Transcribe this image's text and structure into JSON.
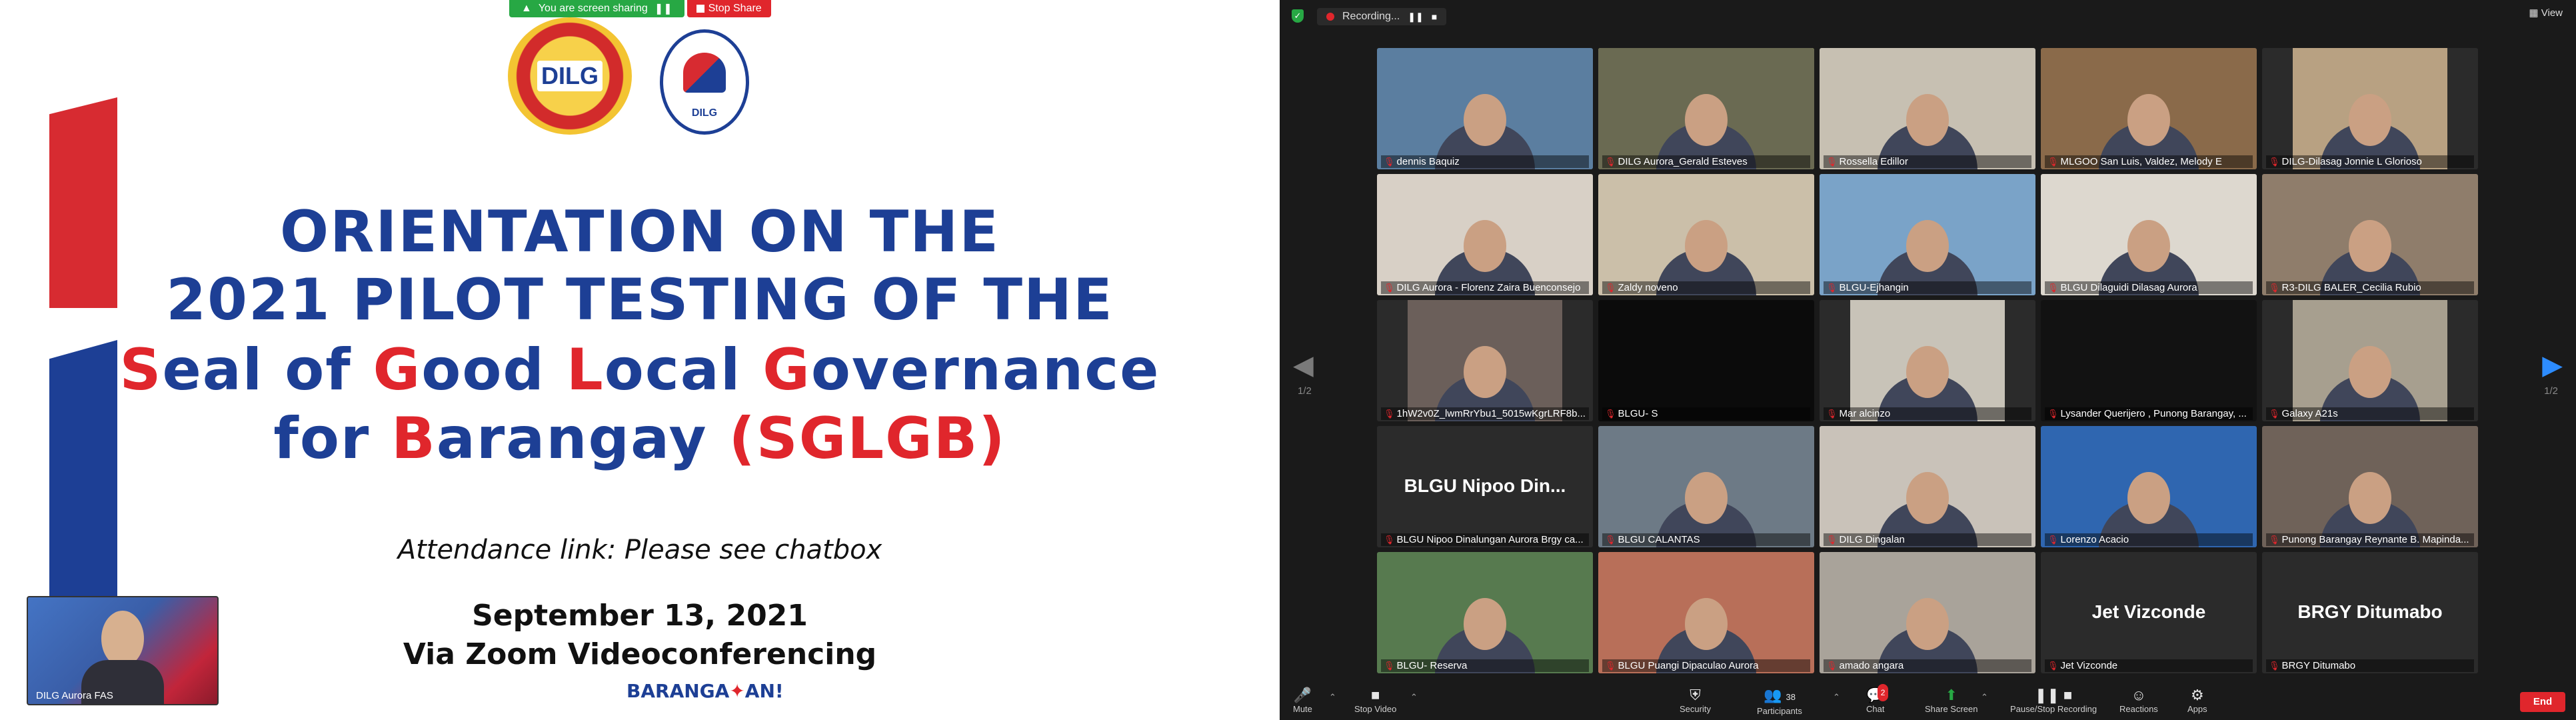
{
  "screen_share": {
    "sharing_text": "You are screen sharing",
    "stop_share_label": "Stop Share"
  },
  "slide": {
    "logo_dilg_text": "DILG",
    "logo_nbo_text": "DILG",
    "title_line1": "ORIENTATION ON THE",
    "title_line2": "2021 PILOT TESTING OF THE",
    "title_line3": {
      "w1_cap": "S",
      "w1_rest": "eal of ",
      "w2_cap": "G",
      "w2_rest": "ood ",
      "w3_cap": "L",
      "w3_rest": "ocal ",
      "w4_cap": "G",
      "w4_rest": "overnance"
    },
    "title_line4": {
      "pre": "for ",
      "cap": "B",
      "rest": "arangay ",
      "acronym": "(SGLGB)"
    },
    "attendance": "Attendance link: Please see chatbox",
    "date": "September 13, 2021",
    "venue": "Via Zoom Videoconferencing",
    "footer_logo_pre": "BARANGA",
    "footer_logo_post": "AN!",
    "self_view_name": "DILG Aurora FAS"
  },
  "zoom": {
    "recording_label": "Recording...",
    "view_label": "View",
    "page_indicator": "1/2",
    "participants": [
      {
        "name": "dennis Baquiz",
        "type": "video"
      },
      {
        "name": "DILG Aurora_Gerald Esteves",
        "type": "video",
        "active": true
      },
      {
        "name": "Rossella Edillor",
        "type": "video"
      },
      {
        "name": "MLGOO San Luis, Valdez, Melody E",
        "type": "video"
      },
      {
        "name": "DILG-Dilasag Jonnie L Glorioso",
        "type": "video"
      },
      {
        "name": "DILG Aurora - Florenz Zaira Buenconsejo",
        "type": "video"
      },
      {
        "name": "Zaldy noveno",
        "type": "video"
      },
      {
        "name": "BLGU-Ejhangin",
        "type": "video"
      },
      {
        "name": "BLGU Dilaguidi Dilasag Aurora",
        "type": "video"
      },
      {
        "name": "R3-DILG BALER_Cecilia Rubio",
        "type": "video"
      },
      {
        "name": "1hW2v0Z_lwmRrYbu1_5015wKgrLRF8b...",
        "type": "video"
      },
      {
        "name": "BLGU- S",
        "type": "video"
      },
      {
        "name": "Mar alcinzo",
        "type": "video"
      },
      {
        "name": "Lysander Querijero , Punong Barangay, ...",
        "type": "video"
      },
      {
        "name": "Galaxy A21s",
        "type": "video"
      },
      {
        "name": "BLGU Nipoo Dinalungan Aurora Brgy ca...",
        "type": "text",
        "big": "BLGU Nipoo Din..."
      },
      {
        "name": "BLGU CALANTAS",
        "type": "video"
      },
      {
        "name": "DILG Dingalan",
        "type": "video"
      },
      {
        "name": "Lorenzo Acacio",
        "type": "video"
      },
      {
        "name": "Punong Barangay Reynante B. Mapinda...",
        "type": "video"
      },
      {
        "name": "BLGU- Reserva",
        "type": "video"
      },
      {
        "name": "BLGU Puangi Dipaculao Aurora",
        "type": "video"
      },
      {
        "name": "amado angara",
        "type": "video"
      },
      {
        "name": "Jet Vizconde",
        "type": "text",
        "big": "Jet Vizconde"
      },
      {
        "name": "BRGY Ditumabo",
        "type": "text",
        "big": "BRGY Ditumabo"
      }
    ],
    "toolbar": {
      "mute": "Mute",
      "stop_video": "Stop Video",
      "security": "Security",
      "participants": "Participants",
      "participant_count": "38",
      "chat": "Chat",
      "chat_badge": "2",
      "share_screen": "Share Screen",
      "pause_recording": "Pause/Stop Recording",
      "reactions": "Reactions",
      "apps": "Apps",
      "end": "End"
    }
  },
  "colors": {
    "accent_blue": "#1d3f95",
    "accent_red": "#e0262c",
    "zoom_green": "#27a844",
    "zoom_bg": "#1a1a1a"
  }
}
